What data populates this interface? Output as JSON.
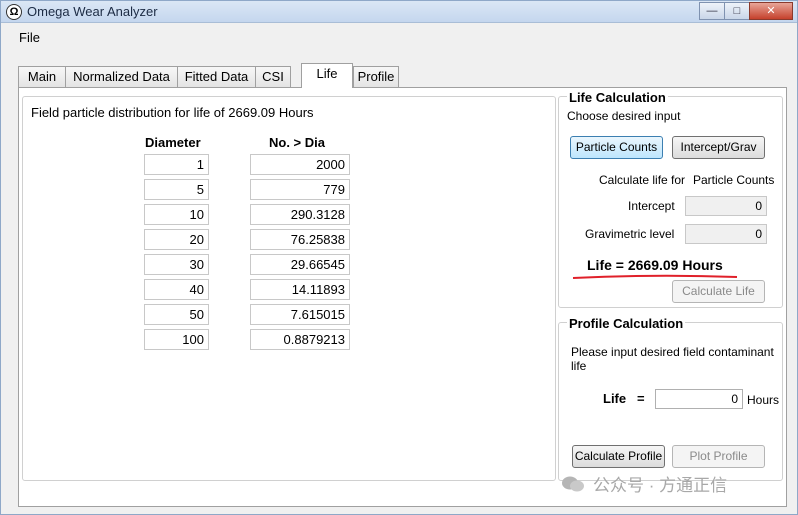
{
  "window": {
    "title": "Omega Wear Analyzer",
    "minimize": "—",
    "maximize": "□",
    "close": "✕"
  },
  "menu": {
    "file": "File"
  },
  "tabs": [
    "Main",
    "Normalized Data",
    "Fitted Data",
    "CSI",
    "Life",
    "Profile"
  ],
  "active_tab": "Life",
  "distribution": {
    "title": "Field particle distribution for life of 2669.09 Hours",
    "col_diameter": "Diameter",
    "col_count": "No. > Dia",
    "rows": [
      {
        "diameter": "1",
        "count": "2000"
      },
      {
        "diameter": "5",
        "count": "779"
      },
      {
        "diameter": "10",
        "count": "290.3128"
      },
      {
        "diameter": "20",
        "count": "76.25838"
      },
      {
        "diameter": "30",
        "count": "29.66545"
      },
      {
        "diameter": "40",
        "count": "14.11893"
      },
      {
        "diameter": "50",
        "count": "7.615015"
      },
      {
        "diameter": "100",
        "count": "0.8879213"
      }
    ]
  },
  "life_calc": {
    "title": "Life Calculation",
    "subtitle": "Choose desired input",
    "btn_particle": "Particle Counts",
    "btn_intercept": "Intercept/Grav",
    "calc_for_label": "Calculate life for",
    "calc_for_value": "Particle Counts",
    "intercept_label": "Intercept",
    "intercept_value": "0",
    "grav_label": "Gravimetric level",
    "grav_value": "0",
    "result": "Life = 2669.09 Hours",
    "btn_calc_life": "Calculate Life"
  },
  "profile_calc": {
    "title": "Profile Calculation",
    "prompt": "Please input desired field contaminant life",
    "life_label": "Life",
    "equals": "=",
    "life_value": "0",
    "unit": "Hours",
    "btn_calc_profile": "Calculate Profile",
    "btn_plot_profile": "Plot Profile"
  },
  "watermark": "公众号 · 方通正信",
  "colors": {
    "accent_underline": "#e0202a",
    "selected_button": "#bee6fd"
  }
}
